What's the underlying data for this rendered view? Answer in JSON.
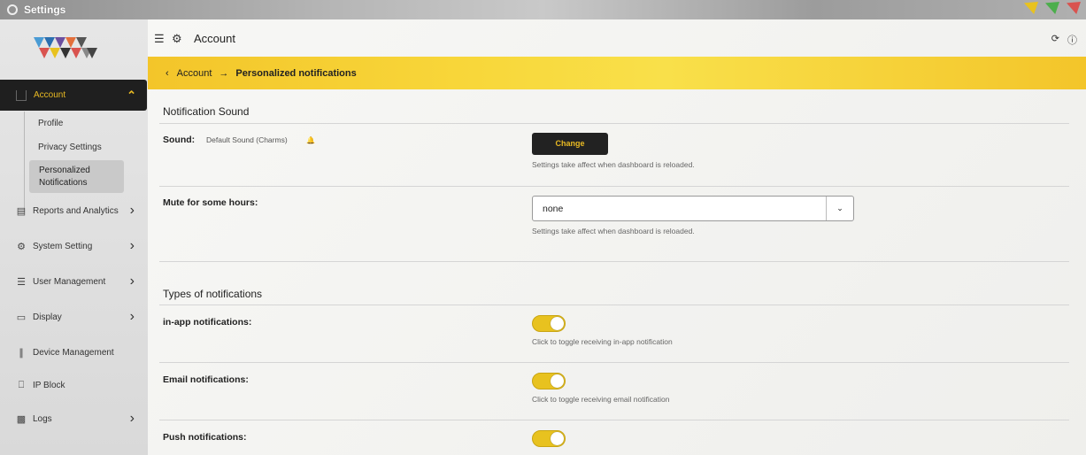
{
  "window": {
    "title": "Settings"
  },
  "sidebar": {
    "active": {
      "label": "Account"
    },
    "sub_items": [
      "Profile",
      "Privacy Settings"
    ],
    "sub_active": {
      "line1": "Personalized",
      "line2": "Notifications"
    },
    "items": [
      {
        "label": "Reports and Analytics",
        "icon": "report-icon",
        "has_chevron": true
      },
      {
        "label": "System Setting",
        "icon": "gear-icon",
        "has_chevron": true
      },
      {
        "label": "User Management",
        "icon": "user-list-icon",
        "has_chevron": true
      },
      {
        "label": "Display",
        "icon": "monitor-icon",
        "has_chevron": true
      },
      {
        "label": "Device Management",
        "icon": "sliders-icon",
        "has_chevron": false
      },
      {
        "label": "IP Block",
        "icon": "lock-icon",
        "has_chevron": false
      },
      {
        "label": "Logs",
        "icon": "document-icon",
        "has_chevron": true
      }
    ]
  },
  "header": {
    "title": "Account"
  },
  "breadcrumb": {
    "parent": "Account",
    "current": "Personalized notifications"
  },
  "notification_sound": {
    "title": "Notification Sound",
    "sound_label": "Sound:",
    "sound_value": "Default Sound (Charms)",
    "change_label": "Change",
    "hint": "Settings take affect when dashboard is reloaded.",
    "mute_label": "Mute for some hours:",
    "mute_value": "none",
    "mute_hint": "Settings take affect when dashboard is reloaded."
  },
  "types": {
    "title": "Types of notifications",
    "inapp_label": "in-app notifications:",
    "inapp_hint": "Click to toggle receiving in-app notification",
    "inapp_on": true,
    "email_label": "Email notifications:",
    "email_hint": "Click to toggle receiving email notification",
    "email_on": true,
    "push_label": "Push notifications:",
    "push_on": true
  },
  "colors": {
    "accent": "#f3c52a",
    "dark": "#1f1f1f",
    "accent_text": "#e8b923"
  }
}
